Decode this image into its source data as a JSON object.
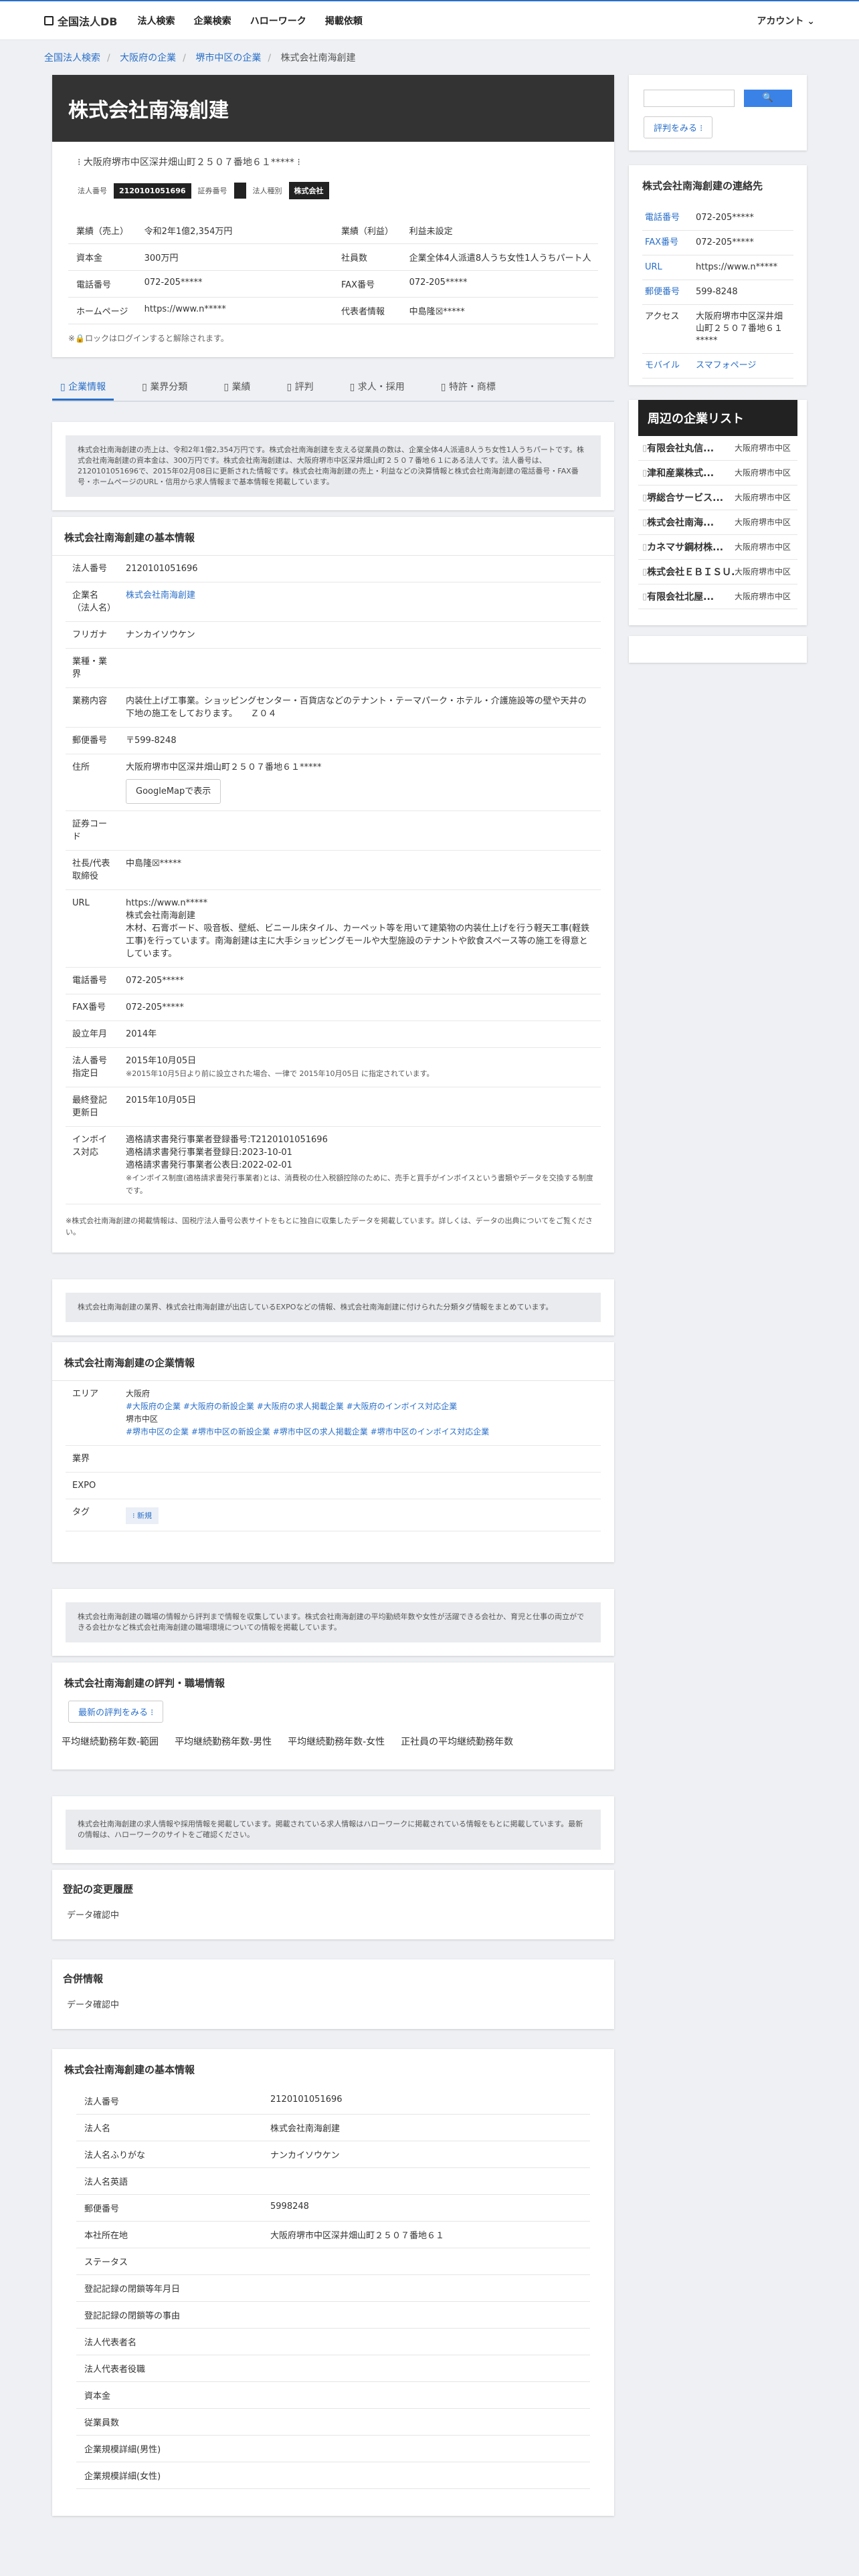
{
  "header": {
    "logo": "全国法人DB",
    "nav": [
      "法人検索",
      "企業検索",
      "ハローワーク",
      "掲載依頼"
    ],
    "account": "アカウント"
  },
  "crumbs": [
    "全国法人検索",
    "大阪府の企業",
    "堺市中区の企業",
    "株式会社南海創建"
  ],
  "company": {
    "name": "株式会社南海創建",
    "address": "大阪府堺市中区深井畑山町２５０７番地６１*****",
    "corp_no_label": "法人番号",
    "corp_no": "2120101051696",
    "sec_label": "証券番号",
    "type_label": "法人種別",
    "type": "株式会社"
  },
  "overview": [
    [
      "業績（売上）",
      "令和2年1億2,354万円",
      "業績（利益）",
      "利益未設定"
    ],
    [
      "資本金",
      "300万円",
      "社員数",
      "企業全体4人派遣8人うち女性1人うちパート人"
    ],
    [
      "電話番号",
      "072-205*****",
      "FAX番号",
      "072-205*****"
    ],
    [
      "ホームページ",
      "https://www.n*****",
      "代表者情報",
      "中島隆☒*****"
    ]
  ],
  "lock_note": "※🔒ロックはログインすると解除されます。",
  "tabs": [
    "企業情報",
    "業界分類",
    "業績",
    "評判",
    "求人・採用",
    "特許・商標"
  ],
  "intro_note": "株式会社南海創建の売上は、令和2年1億2,354万円です。株式会社南海創建を支える従業員の数は、企業全体4人派遣8人うち女性1人うちパートです。株式会社南海創建の資本金は、300万円です。株式会社南海創建は、大阪府堺市中区深井畑山町２５０７番地６１にある法人です。法人番号は、2120101051696で、2015年02月08日に更新された情報です。株式会社南海創建の売上・利益などの決算情報と株式会社南海創建の電話番号・FAX番号・ホームページのURL・信用から求人情報まで基本情報を掲載しています。",
  "basic": {
    "title": "株式会社南海創建の基本情報",
    "rows": [
      [
        "法人番号",
        "2120101051696"
      ],
      [
        "企業名（法人名）",
        "株式会社南海創建"
      ],
      [
        "フリガナ",
        "ナンカイソウケン"
      ],
      [
        "業種・業界",
        ""
      ],
      [
        "業務内容",
        "内装仕上げ工事業。ショッピングセンター・百貨店などのテナント・テーマパーク・ホテル・介護施設等の壁や天井の下地の施工をしております。　　Ｚ０４"
      ],
      [
        "郵便番号",
        "〒599-8248"
      ],
      [
        "住所",
        "大阪府堺市中区深井畑山町２５０７番地６１*****"
      ],
      [
        "証券コード",
        ""
      ],
      [
        "社長/代表取締役",
        "中島隆☒*****"
      ],
      [
        "URL",
        "https://www.n*****\n株式会社南海創建\n木材、石膏ボード、吸音板、壁紙、ビニール床タイル、カーペット等を用いて建築物の内装仕上げを行う軽天工事(軽鉄工事)を行っています。南海創建は主に大手ショッピングモールや大型施設のテナントや飲食スペース等の施工を得意としています。"
      ],
      [
        "電話番号",
        "072-205*****"
      ],
      [
        "FAX番号",
        "072-205*****"
      ],
      [
        "設立年月",
        "2014年"
      ],
      [
        "法人番号指定日",
        "2015年10月05日"
      ],
      [
        "最終登記更新日",
        "2015年10月05日"
      ],
      [
        "インボイス対応",
        "適格請求書発行事業者登録番号:T2120101051696\n適格請求書発行事業者登録日:2023-10-01\n適格請求書発行事業者公表日:2022-02-01"
      ]
    ],
    "gmap": "GoogleMapで表示",
    "designation_note": "※2015年10月5日より前に設立された場合、一律で 2015年10月05日 に指定されています。",
    "invoice_note": "※インボイス制度(適格請求書発行事業者)とは、消費税の仕入税額控除のために、売手と買手がインボイスという書類やデータを交換する制度です。",
    "foot": "※株式会社南海創建の掲載情報は、国税庁法人番号公表サイトをもとに独自に収集したデータを掲載しています。詳しくは、データの出典についてをご覧ください。"
  },
  "industry_note": "株式会社南海創建の業界、株式会社南海創建が出店しているEXPOなどの情報、株式会社南海創建に付けられた分類タグ情報をまとめています。",
  "corp_info": {
    "title": "株式会社南海創建の企業情報",
    "area_label": "エリア",
    "area1": "大阪府",
    "area1_tags": "#大阪府の企業 #大阪府の新設企業 #大阪府の求人掲載企業 #大阪府のインボイス対応企業",
    "area2": "堺市中区",
    "area2_tags": "#堺市中区の企業 #堺市中区の新設企業 #堺市中区の求人掲載企業 #堺市中区のインボイス対応企業",
    "industry_label": "業界",
    "expo_label": "EXPO",
    "tag_label": "タグ",
    "tag": "新規"
  },
  "review_note": "株式会社南海創建の職場の情報から評判まで情報を収集しています。株式会社南海創建の平均勤続年数や女性が活躍できる会社か、育児と仕事の両立ができる会社かなど株式会社南海創建の職場環境についての情報を掲載しています。",
  "review": {
    "title": "株式会社南海創建の評判・職場情報",
    "button": "最新の評判をみる",
    "stats": [
      "平均継続勤務年数-範囲",
      "平均継続勤務年数-男性",
      "平均継続勤務年数-女性",
      "正社員の平均継続勤務年数"
    ]
  },
  "job_note": "株式会社南海創建の求人情報や採用情報を掲載しています。掲載されている求人情報はハローワークに掲載されている情報をもとに掲載しています。最新の情報は、ハローワークのサイトをご確認ください。",
  "history": {
    "title": "登記の変更履歴",
    "text": "データ確認中"
  },
  "merger": {
    "title": "合併情報",
    "text": "データ確認中"
  },
  "basic2": {
    "title": "株式会社南海創建の基本情報",
    "rows": [
      [
        "法人番号",
        "2120101051696"
      ],
      [
        "法人名",
        "株式会社南海創建"
      ],
      [
        "法人名ふりがな",
        "ナンカイソウケン"
      ],
      [
        "法人名英語",
        ""
      ],
      [
        "郵便番号",
        "5998248"
      ],
      [
        "本社所在地",
        "大阪府堺市中区深井畑山町２５０７番地６１"
      ],
      [
        "ステータス",
        ""
      ],
      [
        "登記記録の閉鎖等年月日",
        ""
      ],
      [
        "登記記録の閉鎖等の事由",
        ""
      ],
      [
        "法人代表者名",
        ""
      ],
      [
        "法人代表者役職",
        ""
      ],
      [
        "資本金",
        ""
      ],
      [
        "従業員数",
        ""
      ],
      [
        "企業規模詳細(男性)",
        ""
      ],
      [
        "企業規模詳細(女性)",
        ""
      ]
    ]
  },
  "side": {
    "search_btn": "🔍",
    "review_btn": "評判をみる",
    "contact_title": "株式会社南海創建の連絡先",
    "contact": [
      [
        "電話番号",
        "072-205*****"
      ],
      [
        "FAX番号",
        "072-205*****"
      ],
      [
        "URL",
        "https://www.n*****"
      ],
      [
        "郵便番号",
        "599-8248"
      ],
      [
        "アクセス",
        "大阪府堺市中区深井畑山町２５０７番地６１*****"
      ],
      [
        "モバイル",
        "スマフォページ"
      ]
    ],
    "nearby_title": "周辺の企業リスト",
    "nearby": [
      [
        "有限会社丸信...",
        "大阪府堺市中区"
      ],
      [
        "津和産業株式...",
        "大阪府堺市中区"
      ],
      [
        "堺総合サービス...",
        "大阪府堺市中区"
      ],
      [
        "株式会社南海...",
        "大阪府堺市中区"
      ],
      [
        "カネマサ鋼材株...",
        "大阪府堺市中区"
      ],
      [
        "株式会社ＥＢＩＳＵ...",
        "大阪府堺市中区"
      ],
      [
        "有限会社北屋...",
        "大阪府堺市中区"
      ]
    ]
  }
}
